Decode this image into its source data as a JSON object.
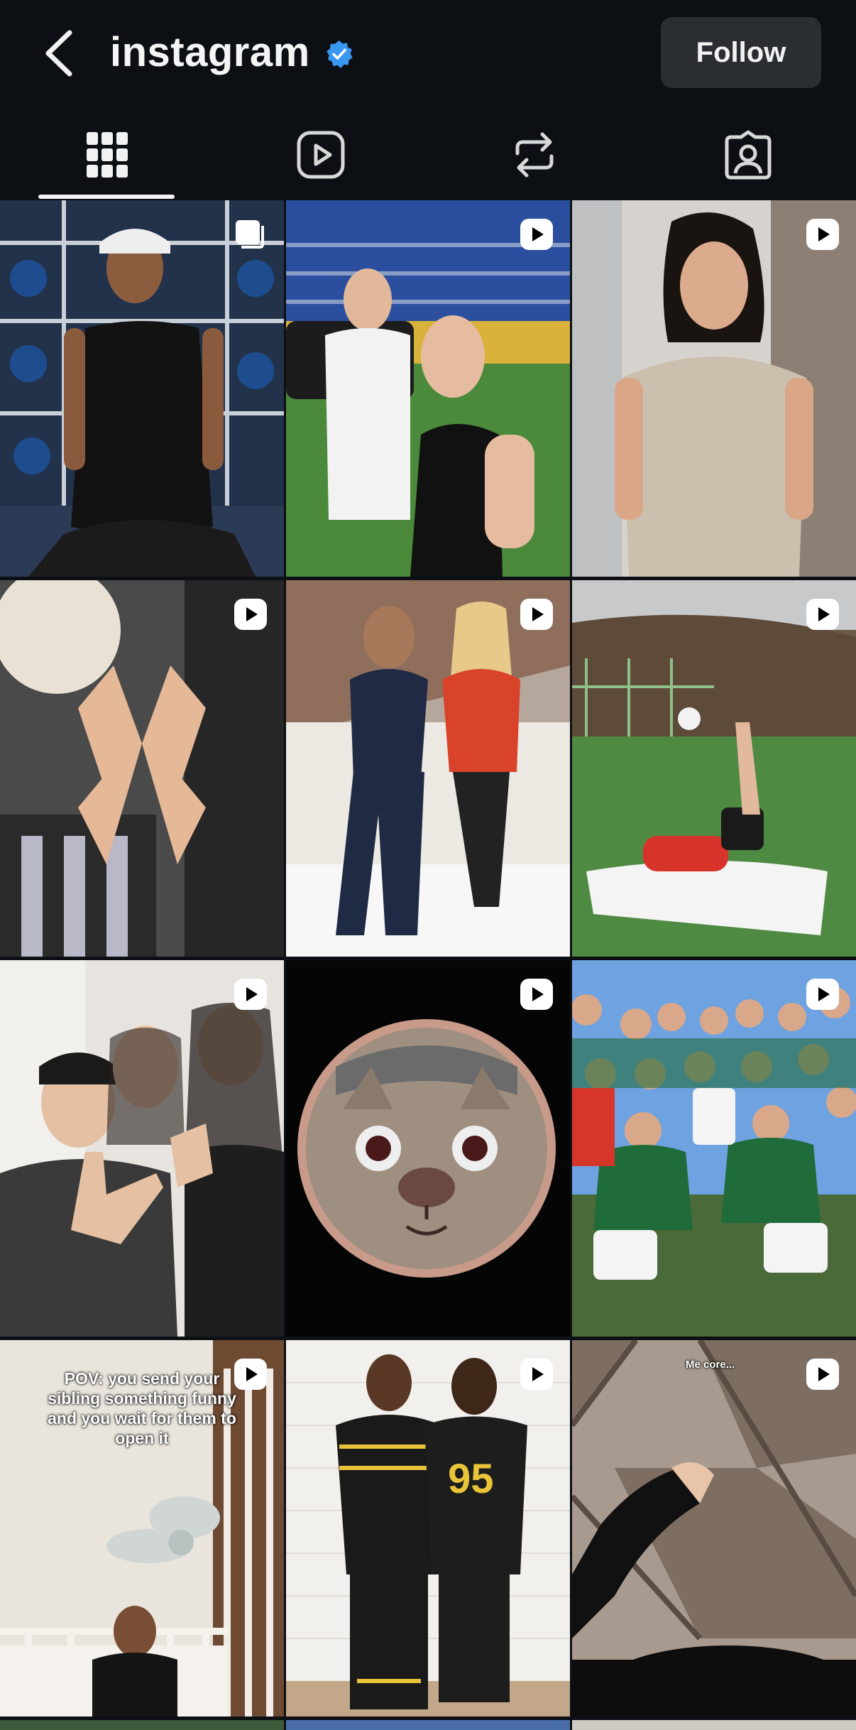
{
  "header": {
    "title": "instagram",
    "follow_label": "Follow",
    "verified_color": "#3897f0"
  },
  "tabs": [
    {
      "name": "grid",
      "icon": "grid-icon",
      "active": true
    },
    {
      "name": "reels",
      "icon": "reels-icon",
      "active": false
    },
    {
      "name": "reposts",
      "icon": "repost-icon",
      "active": false
    },
    {
      "name": "tagged",
      "icon": "tagged-icon",
      "active": false
    }
  ],
  "posts": [
    {
      "type": "carousel",
      "overlay": ""
    },
    {
      "type": "reel",
      "overlay": ""
    },
    {
      "type": "reel",
      "overlay": ""
    },
    {
      "type": "reel",
      "overlay": ""
    },
    {
      "type": "reel",
      "overlay": ""
    },
    {
      "type": "reel",
      "overlay": ""
    },
    {
      "type": "reel",
      "overlay": ""
    },
    {
      "type": "reel",
      "overlay": ""
    },
    {
      "type": "reel",
      "overlay": ""
    },
    {
      "type": "reel",
      "overlay": "POV: you send your sibling something funny and you wait for them to open it"
    },
    {
      "type": "reel",
      "overlay": ""
    },
    {
      "type": "reel",
      "overlay": "Me core..."
    }
  ]
}
